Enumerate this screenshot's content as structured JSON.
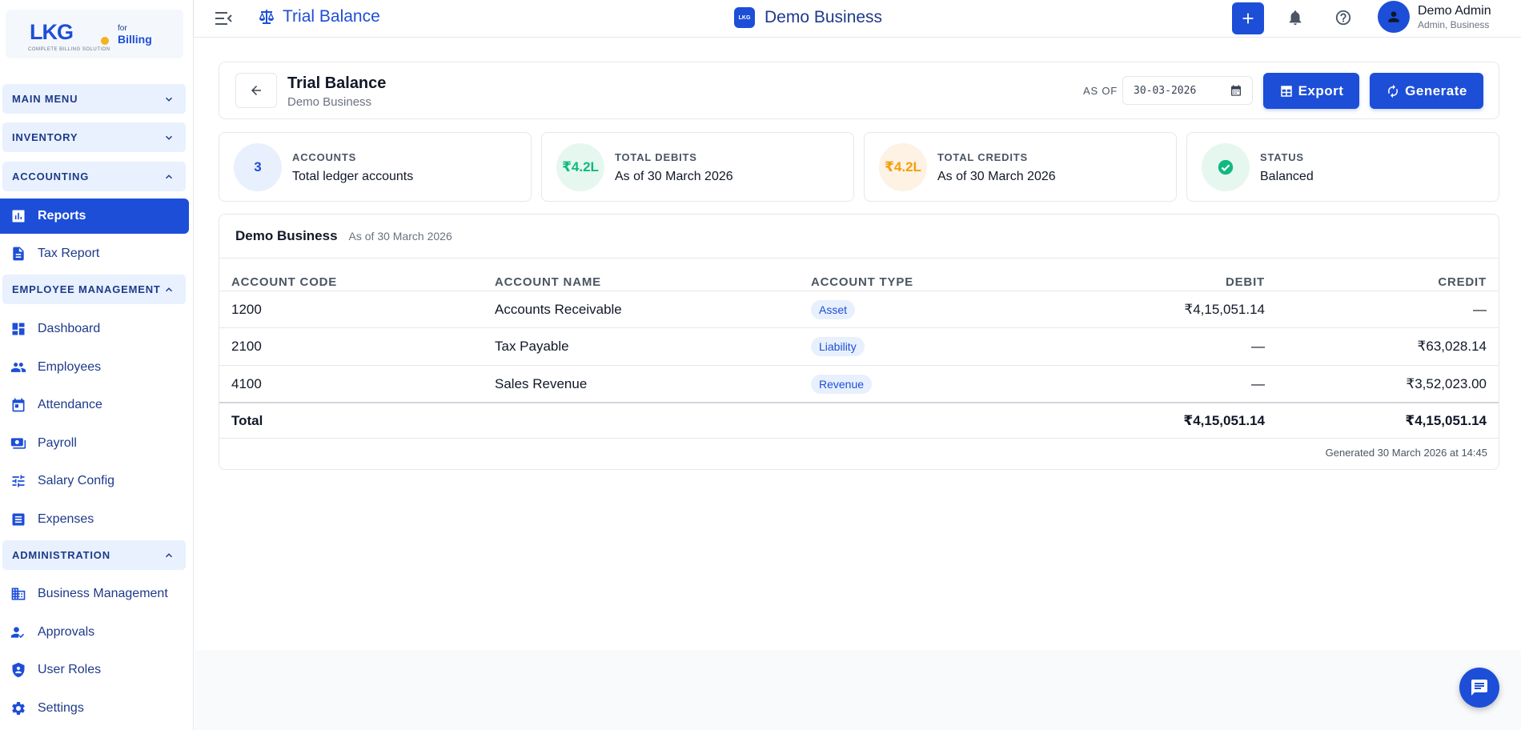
{
  "logo": {
    "brand": "LKG",
    "for": "for",
    "billing": "Billing",
    "tagline": "COMPLETE BILLING SOLUTION"
  },
  "sidebar": {
    "sections": {
      "main_menu": "MAIN MENU",
      "inventory": "INVENTORY",
      "accounting": "ACCOUNTING",
      "employee_management": "EMPLOYEE MANAGEMENT",
      "administration": "ADMINISTRATION"
    },
    "items": {
      "reports": "Reports",
      "tax_report": "Tax Report",
      "dashboard": "Dashboard",
      "employees": "Employees",
      "attendance": "Attendance",
      "payroll": "Payroll",
      "salary_config": "Salary Config",
      "expenses": "Expenses",
      "business_management": "Business Management",
      "approvals": "Approvals",
      "user_roles": "User Roles",
      "settings": "Settings"
    }
  },
  "topbar": {
    "page_title": "Trial Balance",
    "business_name": "Demo Business",
    "business_logo_text": "LKG",
    "user_name": "Demo Admin",
    "user_role": "Admin, Business"
  },
  "header": {
    "title": "Trial Balance",
    "subtitle": "Demo Business",
    "as_of_label": "AS OF",
    "date_value": "30-03-2026",
    "export_label": "Export",
    "generate_label": "Generate"
  },
  "stats": [
    {
      "badge": "3",
      "label": "ACCOUNTS",
      "value": "Total ledger accounts"
    },
    {
      "badge": "₹4.2L",
      "label": "TOTAL DEBITS",
      "value": "As of 30 March 2026"
    },
    {
      "badge": "₹4.2L",
      "label": "TOTAL CREDITS",
      "value": "As of 30 March 2026"
    },
    {
      "badge": "",
      "label": "STATUS",
      "value": "Balanced"
    }
  ],
  "table": {
    "business": "Demo Business",
    "as_of": "As of 30 March 2026",
    "headers": {
      "code": "ACCOUNT CODE",
      "name": "ACCOUNT NAME",
      "type": "ACCOUNT TYPE",
      "debit": "DEBIT",
      "credit": "CREDIT"
    },
    "rows": [
      {
        "code": "1200",
        "name": "Accounts Receivable",
        "type": "Asset",
        "debit": "₹4,15,051.14",
        "credit": "—"
      },
      {
        "code": "2100",
        "name": "Tax Payable",
        "type": "Liability",
        "debit": "—",
        "credit": "₹63,028.14"
      },
      {
        "code": "4100",
        "name": "Sales Revenue",
        "type": "Revenue",
        "debit": "—",
        "credit": "₹3,52,023.00"
      }
    ],
    "total": {
      "label": "Total",
      "debit": "₹4,15,051.14",
      "credit": "₹4,15,051.14"
    },
    "generated": "Generated 30 March 2026 at 14:45"
  },
  "colors": {
    "accent": "#1d4ed8",
    "debit_green": "#10b981",
    "credit_orange": "#f59e0b"
  },
  "icons": [
    "menu-collapse-icon",
    "balance-scale-icon",
    "plus-icon",
    "bell-icon",
    "help-icon",
    "user-icon",
    "back-arrow-icon",
    "calendar-icon",
    "table-icon",
    "refresh-icon",
    "check-circle-icon",
    "chat-icon"
  ]
}
